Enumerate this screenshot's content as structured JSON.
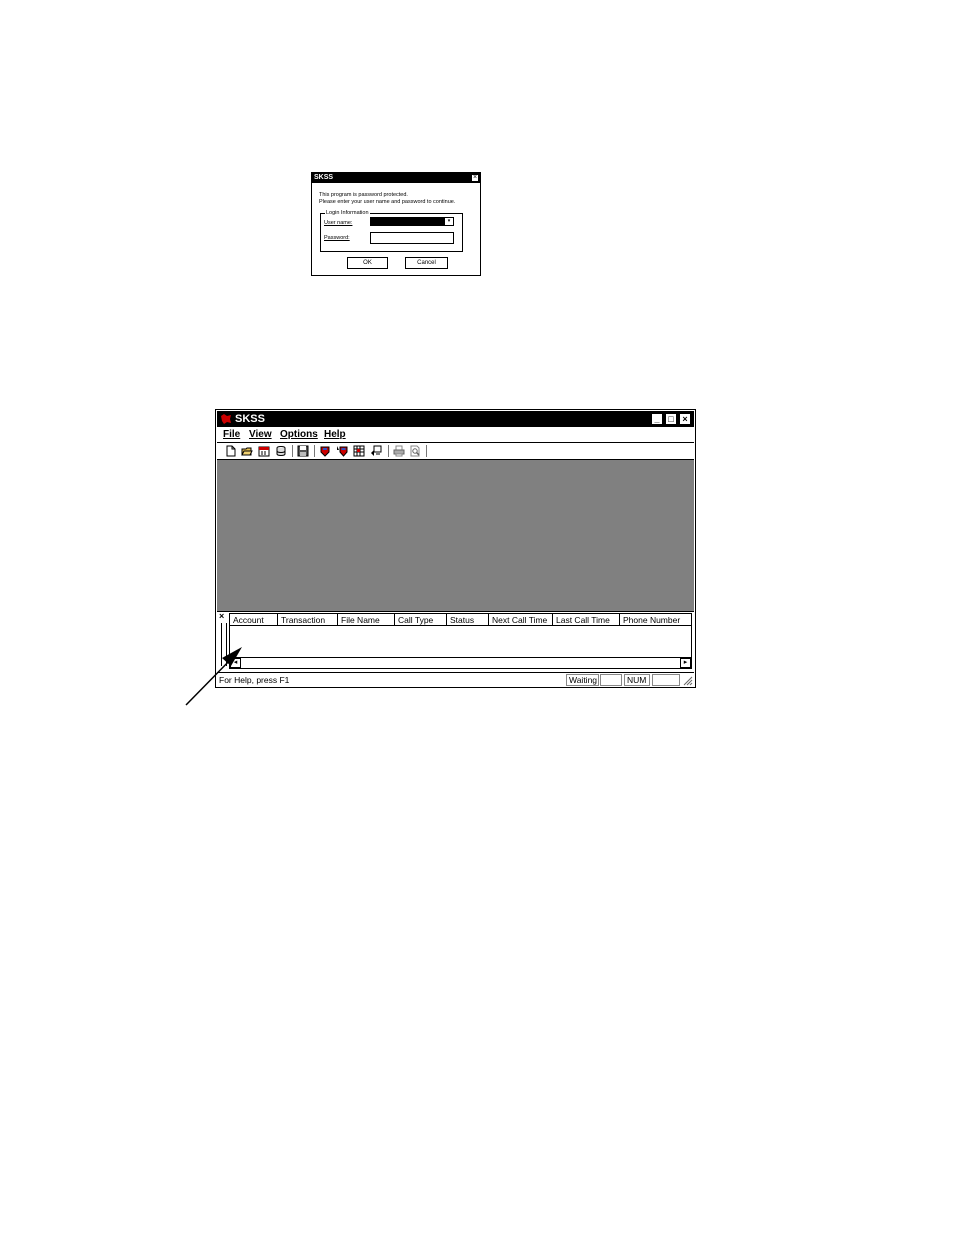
{
  "login_dialog": {
    "title": "SKSS",
    "close_glyph": "×",
    "message_line1": "This program is password protected.",
    "message_line2": "Please enter your user name and password to continue.",
    "group_label": "Login Information",
    "user_name_label": "User name:",
    "password_label": "Password:",
    "dropdown_glyph": "▾",
    "ok_label": "OK",
    "cancel_label": "Cancel"
  },
  "main_window": {
    "title": "SKSS",
    "title_buttons": {
      "minimize": "_",
      "maximize": "□",
      "close": "×"
    },
    "menu": [
      "File",
      "View",
      "Options",
      "Help"
    ],
    "dock_close_glyph": "×",
    "columns": [
      "Account",
      "Transaction",
      "File Name",
      "Call Type",
      "Status",
      "Next Call Time",
      "Last Call Time",
      "Phone Number"
    ],
    "scroll_left_glyph": "◂",
    "scroll_right_glyph": "▸",
    "status": {
      "help_text": "For Help, press F1",
      "state": "Waiting",
      "num": "NUM"
    }
  },
  "colors": {
    "title_bar": "#000000",
    "workspace": "#808080",
    "app_icon": "#cc0000"
  }
}
